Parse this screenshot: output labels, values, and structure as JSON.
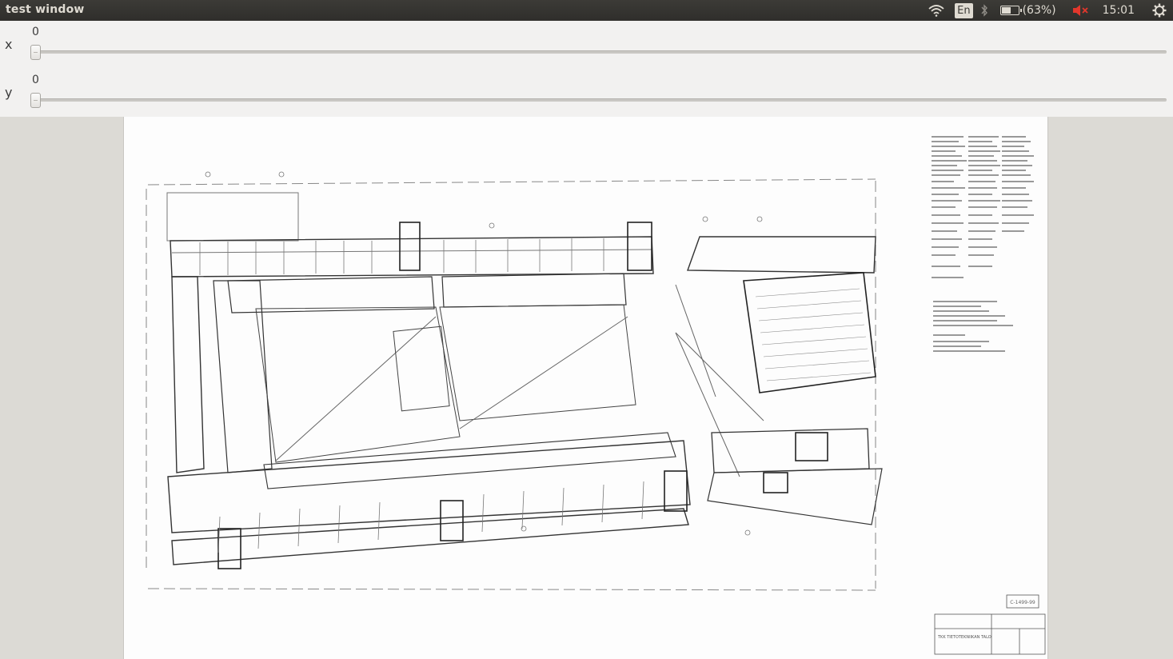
{
  "window": {
    "title": "test window"
  },
  "indicators": {
    "language": "En",
    "battery_text": "(63%)",
    "battery_level": 0.63,
    "time": "15:01",
    "icons": [
      "wifi-icon",
      "language-icon",
      "bluetooth-icon",
      "battery-icon",
      "volume-muted-icon",
      "settings-gear-icon"
    ]
  },
  "sliders": {
    "x": {
      "label": "x",
      "value": "0"
    },
    "y": {
      "label": "y",
      "value": "0"
    }
  },
  "drawing": {
    "subject": "architectural floor plan",
    "stamp_text": "C-1499-99",
    "titleblock_text": "TKK TIETOTEKNIIKAN TALO"
  }
}
